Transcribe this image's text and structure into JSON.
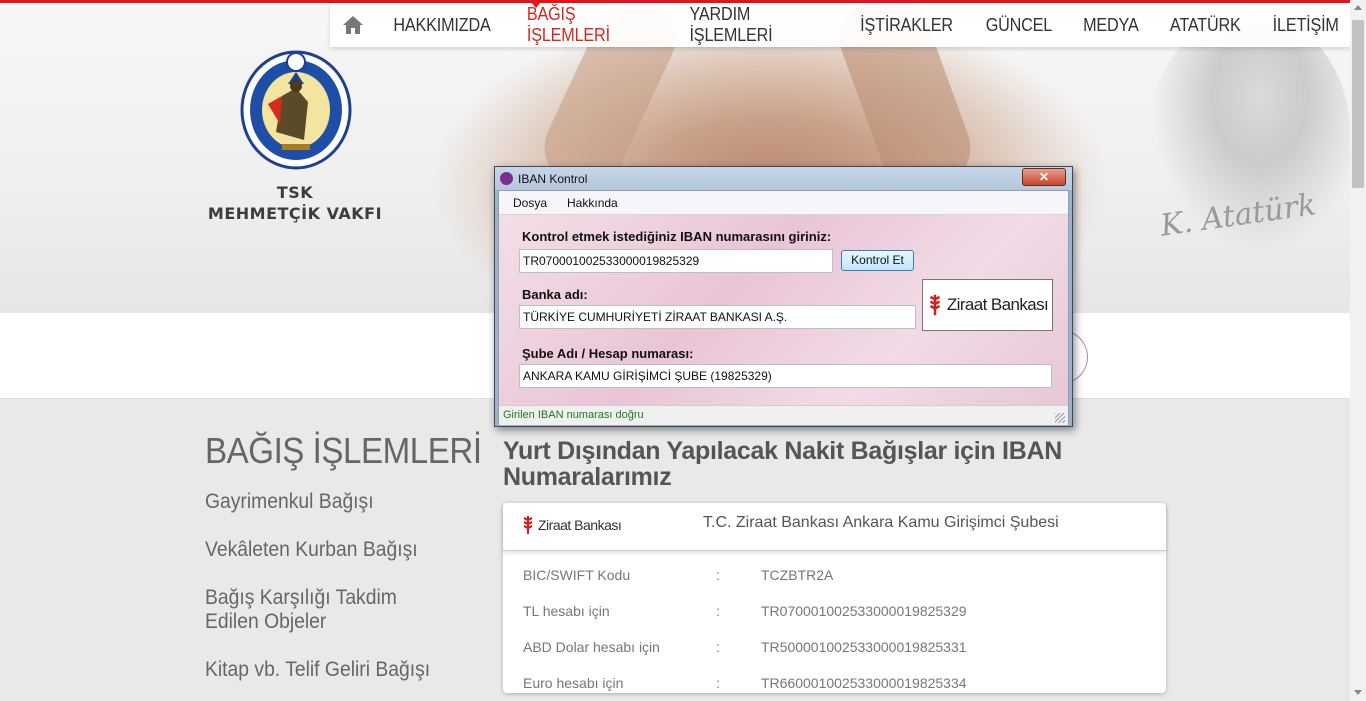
{
  "nav": {
    "items": [
      {
        "label": "HAKKIMIZDA"
      },
      {
        "label": "BAĞIŞ İŞLEMLERİ",
        "active": true
      },
      {
        "label": "YARDIM İŞLEMLERİ"
      },
      {
        "label": "İŞTİRAKLER"
      },
      {
        "label": "GÜNCEL"
      },
      {
        "label": "MEDYA"
      },
      {
        "label": "ATATÜRK"
      },
      {
        "label": "İLETİŞİM"
      }
    ]
  },
  "logo": {
    "line1": "TSK",
    "line2": "MEHMETÇİK VAKFI"
  },
  "sidebar": {
    "title": "BAĞIŞ İŞLEMLERİ",
    "items": [
      "Gayrimenkul Bağışı",
      "Vekâleten Kurban Bağışı",
      "Bağış Karşılığı Takdim Edilen Objeler",
      "Kitap vb. Telif Geliri Bağışı"
    ]
  },
  "main": {
    "title": "Yurt Dışından Yapılacak Nakit Bağışlar için IBAN Numaralarımız",
    "card": {
      "bank_logo": "Ziraat Bankası",
      "title": "T.C. Ziraat Bankası Ankara Kamu Girişimci Şubesi",
      "rows": [
        {
          "key": "BIC/SWIFT Kodu",
          "sep": ":",
          "value": "TCZBTR2A"
        },
        {
          "key": "TL hesabı için",
          "sep": ":",
          "value": "TR070001002533000019825329"
        },
        {
          "key": "ABD Dolar hesabı için",
          "sep": ":",
          "value": "TR500001002533000019825331"
        },
        {
          "key": "Euro hesabı için",
          "sep": ":",
          "value": "TR660001002533000019825334"
        }
      ]
    }
  },
  "dialog": {
    "title": "IBAN Kontrol",
    "close_label": "✕",
    "menu": [
      "Dosya",
      "Hakkında"
    ],
    "iban_label": "Kontrol etmek istediğiniz IBAN numarasını giriniz:",
    "iban_value": "TR070001002533000019825329",
    "check_button": "Kontrol Et",
    "bank_label": "Banka adı:",
    "bank_value": "TÜRKİYE CUMHURİYETİ ZİRAAT BANKASI A.Ş.",
    "bank_logo": "Ziraat Bankası",
    "branch_label": "Şube Adı / Hesap numarası:",
    "branch_value": "ANKARA KAMU GİRİŞİMCİ ŞUBE (19825329)",
    "status": "Girilen IBAN numarası doğru"
  },
  "colors": {
    "accent": "#e3141b",
    "ziraat_red": "#d0201e"
  }
}
